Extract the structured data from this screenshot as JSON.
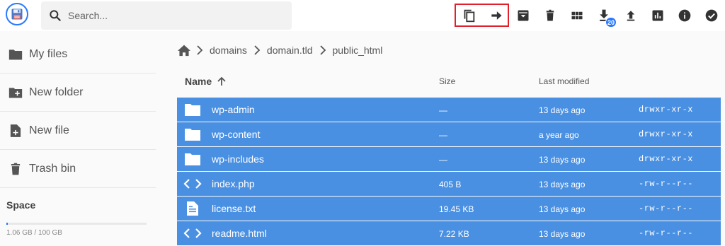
{
  "search": {
    "placeholder": "Search..."
  },
  "sidebar": {
    "items": [
      {
        "label": "My files"
      },
      {
        "label": "New folder"
      },
      {
        "label": "New file"
      },
      {
        "label": "Trash bin"
      }
    ],
    "space": {
      "title": "Space",
      "usage": "1.06 GB / 100 GB",
      "used_fraction": 0.0106
    }
  },
  "toolbar": {
    "download_badge": "20"
  },
  "breadcrumb": [
    "domains",
    "domain.tld",
    "public_html"
  ],
  "table": {
    "headers": {
      "name": "Name",
      "size": "Size",
      "modified": "Last modified"
    },
    "rows": [
      {
        "type": "folder",
        "name": "wp-admin",
        "size": "—",
        "modified": "13 days ago",
        "perm": "drwxr-xr-x"
      },
      {
        "type": "folder",
        "name": "wp-content",
        "size": "—",
        "modified": "a year ago",
        "perm": "drwxr-xr-x"
      },
      {
        "type": "folder",
        "name": "wp-includes",
        "size": "—",
        "modified": "13 days ago",
        "perm": "drwxr-xr-x"
      },
      {
        "type": "code",
        "name": "index.php",
        "size": "405 B",
        "modified": "13 days ago",
        "perm": "-rw-r--r--"
      },
      {
        "type": "text",
        "name": "license.txt",
        "size": "19.45 KB",
        "modified": "13 days ago",
        "perm": "-rw-r--r--"
      },
      {
        "type": "code",
        "name": "readme.html",
        "size": "7.22 KB",
        "modified": "13 days ago",
        "perm": "-rw-r--r--"
      }
    ]
  },
  "colors": {
    "accent": "#2979ff",
    "selected_row": "#4a90e2",
    "highlight": "#e0202a"
  }
}
